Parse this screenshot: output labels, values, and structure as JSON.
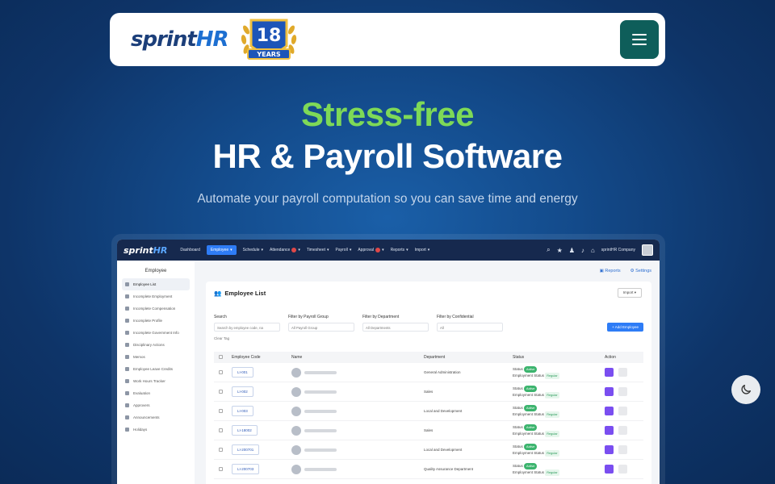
{
  "header": {
    "logo_text_sprint": "sprint",
    "logo_text_hr": "HR",
    "badge_number": "18",
    "badge_label": "YEARS",
    "menu_icon": "hamburger-icon"
  },
  "hero": {
    "line1": "Stress-free",
    "line2": "HR & Payroll Software",
    "subtitle": "Automate your payroll computation so you can save time and energy"
  },
  "app": {
    "logo_sprint": "sprint",
    "logo_hr": "HR",
    "nav": [
      "Dashboard",
      "Employee",
      "Schedule",
      "Attendance",
      "Timesheet",
      "Payroll",
      "Approval",
      "Reports",
      "Import"
    ],
    "user": "sprintHR Company",
    "sidebar_title": "Employee",
    "sidebar": [
      "Employee List",
      "Incomplete Employment",
      "Incomplete Compensation",
      "Incomplete Profile",
      "Incomplete Government Info",
      "Disciplinary Actions",
      "Memos",
      "Employee Leave Credits",
      "Work Hours Tracker",
      "Evaluation",
      "Approvers",
      "Announcements",
      "Holidays"
    ],
    "links": {
      "reports": "Reports",
      "settings": "Settings"
    },
    "list_title": "Employee List",
    "import_label": "Import",
    "filters": {
      "search_label": "Search",
      "search_placeholder": "Search by employee code, na",
      "payroll_label": "Filter by Payroll Group",
      "payroll_value": "All Payroll Group",
      "dept_label": "Filter by Department",
      "dept_value": "All Departments",
      "conf_label": "Filter by Confidential",
      "conf_value": "All",
      "add_label": "+ Add Employee",
      "clear_label": "Clear Tag"
    },
    "table": {
      "headers": [
        "Employee Code",
        "Name",
        "Department",
        "Status",
        "Action"
      ],
      "status_label": "Status",
      "status_value": "Active",
      "emp_status_label": "Employment Status",
      "emp_status_value": "Regular",
      "rows": [
        {
          "code": "LI-001",
          "dept": "General Administration"
        },
        {
          "code": "LI-002",
          "dept": "Sales"
        },
        {
          "code": "LI-003",
          "dept": "Local and Development"
        },
        {
          "code": "LI-18002",
          "dept": "Sales"
        },
        {
          "code": "LI-200701",
          "dept": "Local and Development"
        },
        {
          "code": "LI-200703",
          "dept": "Quality Assurance Department"
        }
      ]
    }
  },
  "theme_toggle_icon": "moon-icon",
  "colors": {
    "hero_accent": "#7ed957",
    "menu_button": "#0e5e5a",
    "primary": "#2e7cf6"
  }
}
